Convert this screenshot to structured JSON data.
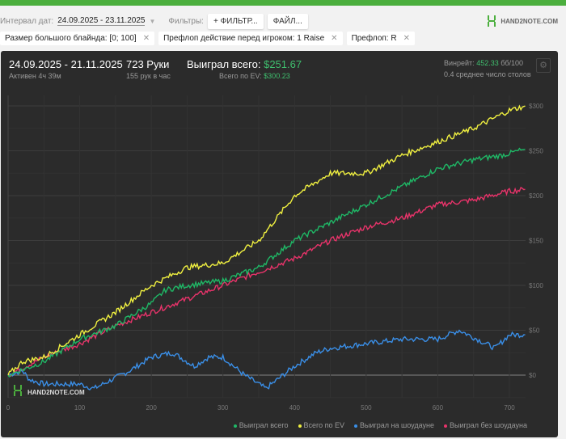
{
  "toolbar": {
    "interval_label": "Интервал дат:",
    "interval_value": "24.09.2025 - 23.11.2025",
    "filters_label": "Фильтры:",
    "filter_button": "+ ФИЛЬТР...",
    "file_button": "ФАЙЛ...",
    "logo": "HAND2NOTE.COM"
  },
  "chips": [
    {
      "label": "Размер большого блайнда: [0; 100]"
    },
    {
      "label": "Префлоп действие перед игроком: 1 Raise"
    },
    {
      "label": "Префлоп: R"
    }
  ],
  "stats": {
    "period": "24.09.2025 - 21.11.2025",
    "active": "Активен 4ч 39м",
    "hands": "723 Руки",
    "hands_per_hour": "155 рук в час",
    "won_label": "Выиграл всего:",
    "won_value": "$251.67",
    "ev_label": "Всего по EV:",
    "ev_value": "$300.23",
    "winrate_label": "Винрейт:",
    "winrate_value": "452.33",
    "winrate_unit": "бб/100",
    "tables": "0.4 среднее число столов"
  },
  "chart_data": {
    "type": "line",
    "xlabel": "",
    "ylabel": "",
    "xlim": [
      0,
      723
    ],
    "ylim": [
      -25,
      310
    ],
    "xticks": [
      "0",
      "100",
      "200",
      "300",
      "400",
      "500",
      "600",
      "700"
    ],
    "yticks": [
      "$0",
      "$50",
      "$100",
      "$150",
      "$200",
      "$250",
      "$300"
    ],
    "watermark": "HAND2NOTE.COM",
    "legend_position": "bottom-right",
    "grid": true,
    "series": [
      {
        "name": "Выиграл всего",
        "color": "#1fb866",
        "x": [
          0,
          50,
          100,
          150,
          200,
          220,
          250,
          300,
          350,
          400,
          450,
          500,
          550,
          600,
          650,
          690,
          723
        ],
        "values": [
          0,
          15,
          40,
          55,
          80,
          95,
          100,
          105,
          120,
          150,
          170,
          190,
          210,
          230,
          240,
          245,
          252
        ]
      },
      {
        "name": "Всего по EV",
        "color": "#f0f040",
        "x": [
          0,
          20,
          50,
          100,
          150,
          200,
          250,
          300,
          350,
          400,
          450,
          500,
          550,
          600,
          650,
          700,
          723
        ],
        "values": [
          0,
          15,
          20,
          45,
          70,
          100,
          120,
          125,
          150,
          200,
          225,
          225,
          245,
          260,
          275,
          295,
          300
        ]
      },
      {
        "name": "Выиграл на шоудауне",
        "color": "#3a8fe8",
        "x": [
          0,
          20,
          30,
          50,
          100,
          120,
          170,
          200,
          230,
          260,
          280,
          300,
          330,
          360,
          400,
          430,
          450,
          500,
          550,
          600,
          630,
          680,
          700,
          723
        ],
        "values": [
          0,
          5,
          -5,
          -10,
          -10,
          -15,
          5,
          20,
          25,
          10,
          20,
          20,
          0,
          -15,
          10,
          25,
          30,
          35,
          40,
          40,
          50,
          30,
          45,
          45
        ]
      },
      {
        "name": "Выиграл без шоудауна",
        "color": "#e8336a",
        "x": [
          0,
          50,
          100,
          150,
          200,
          250,
          300,
          350,
          400,
          450,
          500,
          550,
          600,
          650,
          700,
          723
        ],
        "values": [
          0,
          20,
          35,
          55,
          70,
          85,
          100,
          115,
          130,
          150,
          165,
          175,
          190,
          195,
          205,
          207
        ]
      }
    ]
  }
}
